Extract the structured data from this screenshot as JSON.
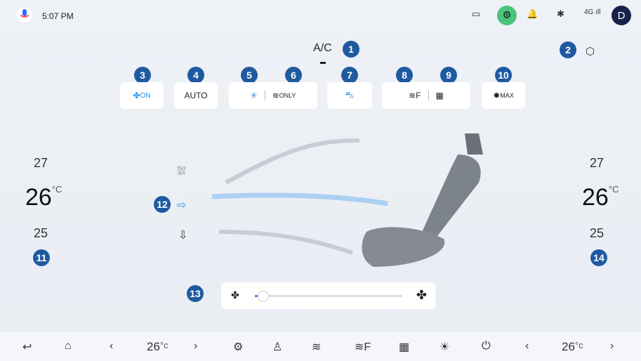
{
  "status": {
    "time": "5:07 PM",
    "avatar": "D",
    "network": "4G"
  },
  "ac": {
    "label": "A/C",
    "setting_badge": "2"
  },
  "buttons": [
    {
      "badge": "3",
      "text": "ON",
      "icon": "fan-icon"
    },
    {
      "badge": "4",
      "text": "AUTO"
    },
    {
      "badge": "5",
      "icon": "snow-icon"
    },
    {
      "badge": "6",
      "text": "ONLY",
      "icon": "airflow-icon"
    },
    {
      "badge": "7",
      "icon": "recirculation-icon"
    },
    {
      "badge": "8",
      "text": "F",
      "icon": "front-defrost-icon"
    },
    {
      "badge": "9",
      "icon": "rear-defrost-icon"
    },
    {
      "badge": "10",
      "text": "MAX",
      "icon": "max-ac-icon"
    }
  ],
  "left_zone": {
    "badge": "11",
    "up": "27",
    "current": "26",
    "down": "25",
    "unit": "°C"
  },
  "right_zone": {
    "badge": "14",
    "up": "27",
    "current": "26",
    "down": "25",
    "unit": "°C"
  },
  "vents": {
    "badge": "12"
  },
  "fan": {
    "badge": "13",
    "level": 0.05
  },
  "bottom": {
    "left_temp": "26",
    "right_temp": "26",
    "unit": "°c"
  }
}
